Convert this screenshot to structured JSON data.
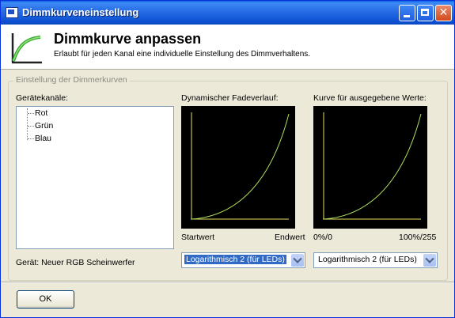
{
  "window": {
    "title": "Dimmkurveneinstellung"
  },
  "header": {
    "title": "Dimmkurve anpassen",
    "subtitle": "Erlaubt für jeden Kanal eine individuelle Einstellung des Dimmverhaltens."
  },
  "group": {
    "legend": "Einstellung der Dimmerkurven",
    "channels_label": "Gerätekanäle:",
    "channels": [
      "Rot",
      "Grün",
      "Blau"
    ],
    "device_text": "Gerät: Neuer RGB Scheinwerfer"
  },
  "fade_graph": {
    "label": "Dynamischer Fadeverlauf:",
    "start_label": "Startwert",
    "end_label": "Endwert",
    "curve_color": "#b0e060",
    "combo_value": "Logarithmisch 2 (für LEDs)"
  },
  "output_graph": {
    "label": "Kurve für ausgegebene Werte:",
    "start_label": "0%/0",
    "end_label": "100%/255",
    "curve_color": "#b0e060",
    "combo_value": "Logarithmisch 2 (für LEDs)"
  },
  "footer": {
    "ok_label": "OK"
  }
}
